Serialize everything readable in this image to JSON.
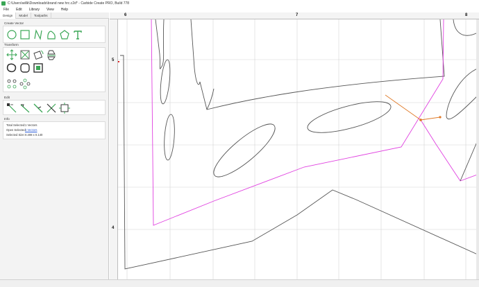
{
  "window": {
    "title": "C:\\Users\\willk\\Downloads\\brand new hrc.c2d* - Carbide Create PRO, Build 778"
  },
  "menu": {
    "items": [
      "File",
      "Edit",
      "Library",
      "View",
      "Help"
    ]
  },
  "tabs": [
    "Design",
    "Model",
    "Toolpaths"
  ],
  "sidebar": {
    "create_vector_label": "Create Vector",
    "transform_label": "Transform",
    "edit_label": "Edit",
    "info_label": "Info",
    "info": {
      "total_selected_label": "Total Selected:",
      "total_selected_value": "1 Vectors",
      "open_selected_label": "Open Selected:",
      "open_selected_value": "1 Vectors",
      "selected_size_label": "Selected Size:",
      "selected_size_value": "0.308 x 0.140"
    },
    "accent_color": "#3aa655"
  },
  "rulers": {
    "horizontal": [
      "6",
      "7",
      "8"
    ],
    "vertical": [
      "5",
      "4"
    ]
  },
  "canvas": {
    "selection_color": "#e040e0",
    "vector_color": "#555555",
    "handle_color": "#e07b2a"
  }
}
